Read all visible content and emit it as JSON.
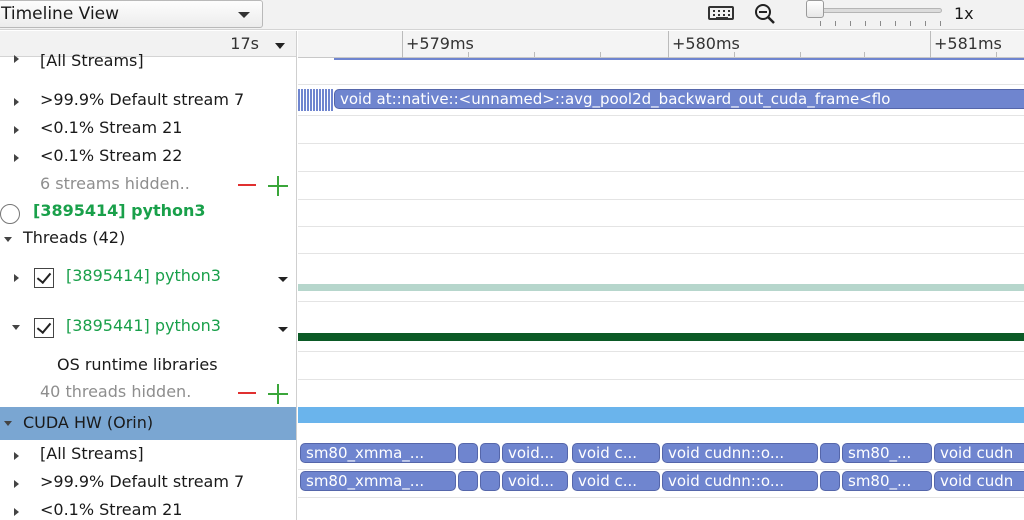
{
  "toolbar": {
    "view_name": "Timeline View",
    "zoom_level": "1x",
    "zoom_slider_value": 0
  },
  "tree": {
    "header_time": "17s",
    "rows": [
      {
        "label": "[All Streams]"
      },
      {
        "label": ">99.9% Default stream 7"
      },
      {
        "label": "<0.1% Stream 21"
      },
      {
        "label": "<0.1% Stream 22"
      },
      {
        "label": "6 streams hidden.."
      },
      {
        "label": "[3895414] python3"
      },
      {
        "label": "Threads (42)"
      },
      {
        "label": "[3895414] python3"
      },
      {
        "label": "[3895441] python3"
      },
      {
        "label": "OS runtime libraries"
      },
      {
        "label": "40 threads hidden."
      },
      {
        "label": "CUDA HW (Orin)"
      },
      {
        "label": "[All Streams]"
      },
      {
        "label": ">99.9% Default stream 7"
      },
      {
        "label": "<0.1% Stream 21"
      }
    ]
  },
  "timeline": {
    "ruler_labels": [
      "+579ms",
      "+580ms",
      "+581ms"
    ],
    "kernel_main": "void at::native::<unnamed>::avg_pool2d_backward_out_cuda_frame<flo",
    "hw_row1": [
      "sm80_xmma_...",
      "",
      "",
      "void...",
      "void c...",
      "void cudnn::o...",
      "",
      "sm80_...",
      "void cudn"
    ],
    "hw_row2": [
      "sm80_xmma_...",
      "",
      "",
      "void...",
      "void c...",
      "void cudnn::o...",
      "",
      "sm80_...",
      "void cudn"
    ]
  },
  "colors": {
    "kernel": "#6f85cf",
    "selected_row": "#7aa6d2",
    "cuda_band": "#6ab4ec",
    "thread_green": "#0b5a26",
    "process_green": "#19a04a"
  }
}
